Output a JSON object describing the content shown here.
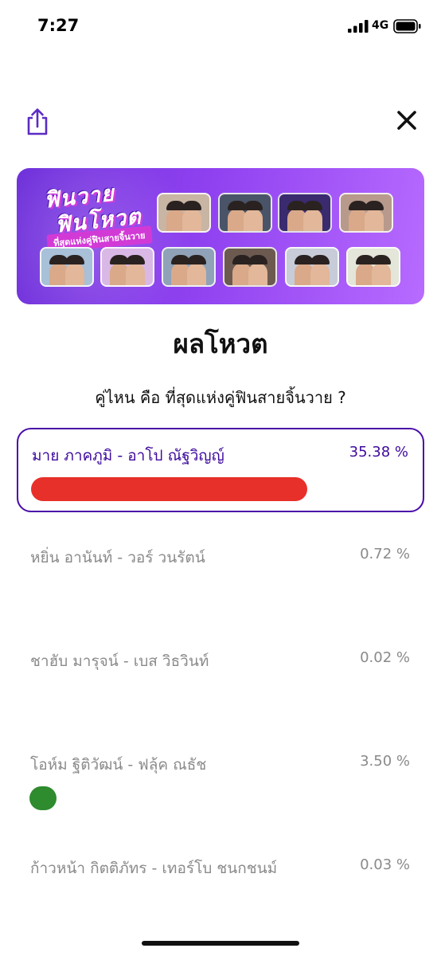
{
  "status_bar": {
    "time": "7:27",
    "network": "4G"
  },
  "header": {
    "share_icon": "share-icon",
    "close_icon": "close-icon"
  },
  "banner": {
    "logo_line_1": "ฟินวาย",
    "logo_line_2": "ฟินโหวต",
    "tagline": "ที่สุดแห่งคู่ฟินสายจิ้นวาย",
    "colors": {
      "gradient_start": "#6d2fd9",
      "gradient_end": "#b86bff",
      "tagline_bg": "#d23ad6"
    }
  },
  "result": {
    "title": "ผลโหวต",
    "question": "คู่ไหน คือ ที่สุดแห่งคู่ฟินสายจิ้นวาย ?"
  },
  "options": [
    {
      "label": "มาย ภาคภูมิ - อาโป ณัฐวิญญ์",
      "percent_text": "35.38 %",
      "share": 0.3538,
      "selected": true,
      "bar_color": "#e8302a"
    },
    {
      "label": "หยิ่น อานันท์  - วอร์ วนรัตน์",
      "percent_text": "0.72 %",
      "share": 0.0072,
      "selected": false,
      "bar_color": ""
    },
    {
      "label": "ชาฮับ มารุจน์ - เบส วิธวินท์",
      "percent_text": "0.02 %",
      "share": 0.0002,
      "selected": false,
      "bar_color": ""
    },
    {
      "label": "โอห์ม ฐิติวัฒน์ - ฟลุ้ค ณธัช",
      "percent_text": "3.50 %",
      "share": 0.035,
      "selected": false,
      "bar_color": "#2e8b2e"
    },
    {
      "label": "ก้าวหน้า กิตติภัทร - เทอร์โบ ชนกชนม์",
      "percent_text": "0.03 %",
      "share": 0.0003,
      "selected": false,
      "bar_color": ""
    }
  ],
  "colors": {
    "selected_border": "#4a0ca8",
    "selected_text": "#3d0a9e",
    "plain_text": "#8a8a8a"
  }
}
